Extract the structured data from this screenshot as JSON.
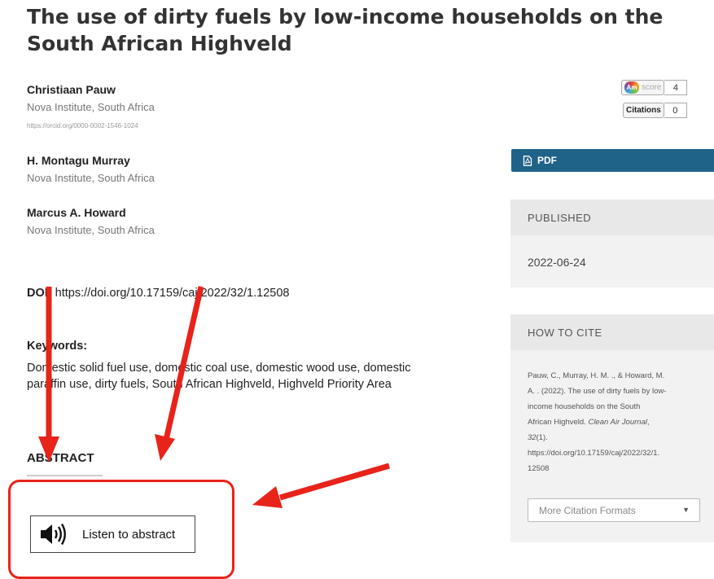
{
  "article": {
    "title": "The use of dirty fuels by low-income households on the South African Highveld",
    "doi_label": "DOI:",
    "doi": "https://doi.org/10.17159/caj/2022/32/1.12508",
    "keywords_label": "Keywords:",
    "keywords_line1": "Domestic solid fuel use, domestic coal use, domestic wood use, domestic",
    "keywords_line2": "paraffin use, dirty fuels, South African Highveld, Highveld Priority Area",
    "abstract_heading": "ABSTRACT"
  },
  "authors": [
    {
      "name": "Christiaan Pauw",
      "affiliation": "Nova Institute, South Africa",
      "orcid": "https://orcid.org/0000-0002-1546-1024"
    },
    {
      "name": "H. Montagu Murray",
      "affiliation": "Nova Institute, South Africa"
    },
    {
      "name": "Marcus A. Howard",
      "affiliation": "Nova Institute, South Africa"
    }
  ],
  "badges": {
    "altmetric_logo": "Am",
    "altmetric_label": "score",
    "altmetric_value": "4",
    "citations_label": "Citations",
    "citations_value": "0"
  },
  "sidebar": {
    "pdf_label": "PDF",
    "published_heading": "PUBLISHED",
    "published_date": "2022-06-24",
    "cite_heading": "HOW TO CITE",
    "citation_line1": "Pauw, C., Murray, H. M. ., & Howard, M.",
    "citation_line2": "A. . (2022). The use of dirty fuels by low-",
    "citation_line3": "income households on the South",
    "citation_line4_pre": "African Highveld. ",
    "citation_journal": "Clean Air Journal",
    "citation_line4_post": ",",
    "citation_volume": "32",
    "citation_issue": "(1).",
    "citation_doi1": "https://doi.org/10.17159/caj/2022/32/1.",
    "citation_doi2": "12508",
    "citation_formats_label": "More Citation Formats"
  },
  "audio": {
    "listen_label": "Listen to abstract"
  },
  "annotation": {
    "color": "#e8231a"
  }
}
